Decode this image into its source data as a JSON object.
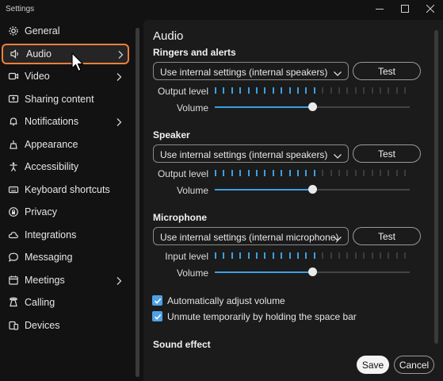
{
  "window": {
    "title": "Settings",
    "controls": [
      {
        "name": "minimize-button",
        "icon": "minimize-icon"
      },
      {
        "name": "maximize-button",
        "icon": "maximize-icon"
      },
      {
        "name": "close-button",
        "icon": "close-icon"
      }
    ]
  },
  "colors": {
    "accent": "#3d9fe0",
    "selection_outline": "#f07f3c",
    "panel_bg": "#1b1b1b",
    "window_bg": "#121212"
  },
  "sidebar": {
    "selected": "Audio",
    "items": [
      {
        "label": "General",
        "icon": "gear-icon",
        "has_chevron": false
      },
      {
        "label": "Audio",
        "icon": "speaker-icon",
        "has_chevron": true
      },
      {
        "label": "Video",
        "icon": "video-camera-icon",
        "has_chevron": true
      },
      {
        "label": "Sharing content",
        "icon": "share-screen-icon",
        "has_chevron": false
      },
      {
        "label": "Notifications",
        "icon": "bell-icon",
        "has_chevron": true
      },
      {
        "label": "Appearance",
        "icon": "appearance-icon",
        "has_chevron": false
      },
      {
        "label": "Accessibility",
        "icon": "accessibility-icon",
        "has_chevron": false
      },
      {
        "label": "Keyboard shortcuts",
        "icon": "keyboard-icon",
        "has_chevron": false
      },
      {
        "label": "Privacy",
        "icon": "privacy-icon",
        "has_chevron": false
      },
      {
        "label": "Integrations",
        "icon": "cloud-icon",
        "has_chevron": false
      },
      {
        "label": "Messaging",
        "icon": "chat-bubble-icon",
        "has_chevron": false
      },
      {
        "label": "Meetings",
        "icon": "calendar-icon",
        "has_chevron": true
      },
      {
        "label": "Calling",
        "icon": "phone-icon",
        "has_chevron": false
      },
      {
        "label": "Devices",
        "icon": "devices-icon",
        "has_chevron": false
      }
    ]
  },
  "audio": {
    "title": "Audio",
    "sections": [
      {
        "heading": "Ringers and alerts",
        "device": "Use internal settings (internal speakers)",
        "test_label": "Test",
        "level_label": "Output level",
        "level_active_fraction": 0.55,
        "volume_label": "Volume",
        "volume_fraction": 0.5
      },
      {
        "heading": "Speaker",
        "device": "Use internal settings (internal speakers)",
        "test_label": "Test",
        "level_label": "Output level",
        "level_active_fraction": 0.55,
        "volume_label": "Volume",
        "volume_fraction": 0.5
      },
      {
        "heading": "Microphone",
        "device": "Use internal settings (internal microphone)",
        "test_label": "Test",
        "level_label": "Input level",
        "level_active_fraction": 0.55,
        "volume_label": "Volume",
        "volume_fraction": 0.5
      }
    ],
    "checkboxes": [
      {
        "label": "Automatically adjust volume",
        "checked": true
      },
      {
        "label": "Unmute temporarily by holding the space bar",
        "checked": true
      }
    ],
    "sound_effect_heading": "Sound effect"
  },
  "footer": {
    "save_label": "Save",
    "cancel_label": "Cancel"
  }
}
